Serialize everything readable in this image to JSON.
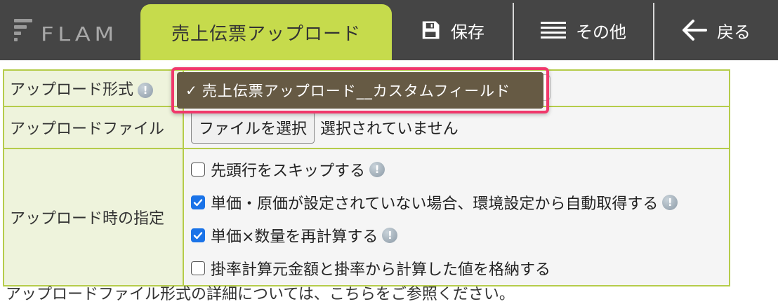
{
  "header": {
    "logo_text": "FLAM",
    "active_tab": "売上伝票アップロード",
    "buttons": {
      "save": "保存",
      "more": "その他",
      "back": "戻る"
    }
  },
  "form": {
    "upload_format": {
      "label": "アップロード形式",
      "selected_option": "売上伝票アップロード__カスタムフィールド"
    },
    "upload_file": {
      "label": "アップロードファイル",
      "button_label": "ファイルを選択",
      "status": "選択されていません"
    },
    "upload_options": {
      "label": "アップロード時の指定",
      "options": [
        {
          "label": "先頭行をスキップする",
          "checked": false,
          "info": true
        },
        {
          "label": "単価・原価が設定されていない場合、環境設定から自動取得する",
          "checked": true,
          "info": true
        },
        {
          "label": "単価×数量を再計算する",
          "checked": true,
          "info": true
        },
        {
          "label": "掛率計算元金額と掛率から計算した値を格納する",
          "checked": false,
          "info": false
        }
      ]
    }
  },
  "footer_partial_text": "アップロードファイル形式の詳細については、こちらをご参照ください。",
  "colors": {
    "header_bg": "#454545",
    "accent_green": "#c6db4c",
    "table_border": "#b5cc4a",
    "highlight": "#f0386b",
    "dropdown_bg": "#665a44",
    "checkbox_blue": "#1a73e8"
  }
}
